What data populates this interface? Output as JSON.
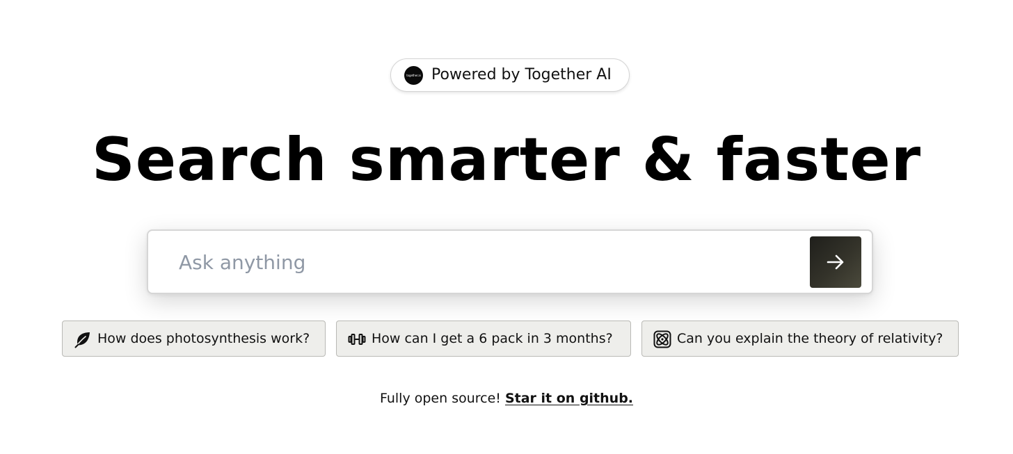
{
  "badge": {
    "logo_text": "together.ai",
    "label": "Powered by Together AI"
  },
  "hero": {
    "title": "Search smarter & faster"
  },
  "search": {
    "placeholder": "Ask anything",
    "value": "",
    "submit_icon": "arrow-right-icon"
  },
  "suggestions": [
    {
      "icon": "leaf-icon",
      "label": "How does photosynthesis work?"
    },
    {
      "icon": "dumbbell-icon",
      "label": "How can I get a 6 pack in 3 months?"
    },
    {
      "icon": "atom-icon",
      "label": "Can you explain the theory of relativity?"
    }
  ],
  "footer": {
    "text": "Fully open source!",
    "link_label": "Star it on github."
  },
  "colors": {
    "background": "#ffffff",
    "submit_button": "#2a2a24",
    "chip_background": "#eeeeeb",
    "placeholder": "#8f98a5"
  }
}
